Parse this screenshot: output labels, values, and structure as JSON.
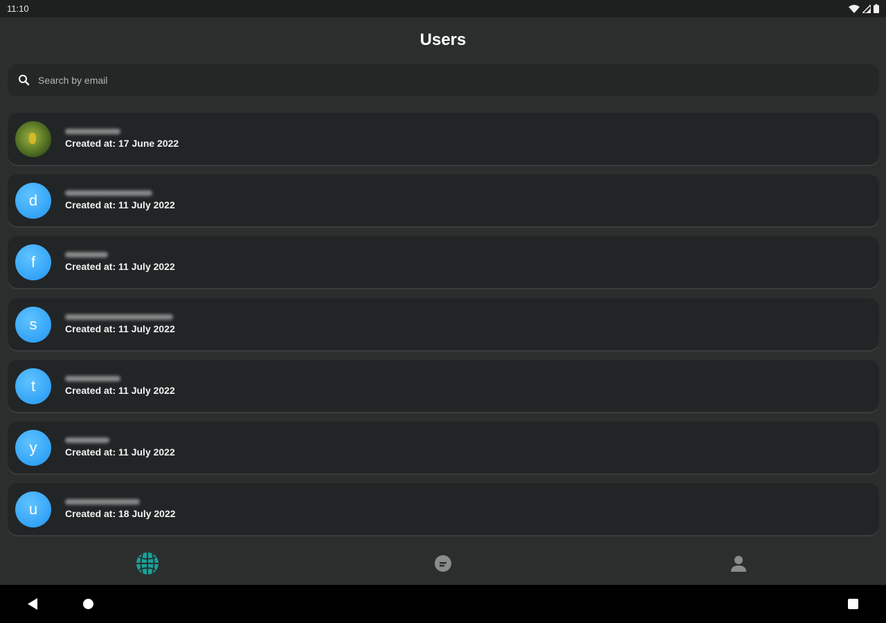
{
  "status_bar": {
    "time": "11:10"
  },
  "header": {
    "title": "Users"
  },
  "search": {
    "placeholder": "Search by email",
    "value": ""
  },
  "users": [
    {
      "avatar_letter": "",
      "avatar_type": "photo",
      "created": "Created at: 17 June 2022"
    },
    {
      "avatar_letter": "d",
      "avatar_type": "letter",
      "created": "Created at: 11 July 2022"
    },
    {
      "avatar_letter": "f",
      "avatar_type": "letter",
      "created": "Created at: 11 July 2022"
    },
    {
      "avatar_letter": "s",
      "avatar_type": "letter",
      "created": "Created at: 11 July 2022"
    },
    {
      "avatar_letter": "t",
      "avatar_type": "letter",
      "created": "Created at: 11 July 2022"
    },
    {
      "avatar_letter": "y",
      "avatar_type": "letter",
      "created": "Created at: 11 July 2022"
    },
    {
      "avatar_letter": "u",
      "avatar_type": "letter",
      "created": "Created at: 18 July 2022"
    }
  ],
  "bottom_nav": [
    {
      "icon": "globe-icon",
      "active": true
    },
    {
      "icon": "chat-bubble-icon",
      "active": false
    },
    {
      "icon": "person-icon",
      "active": false
    }
  ],
  "colors": {
    "accent": "#1aa198",
    "avatar_blue": "#2196f3",
    "card_bg": "#222526",
    "app_bg": "#2c2e2e"
  }
}
